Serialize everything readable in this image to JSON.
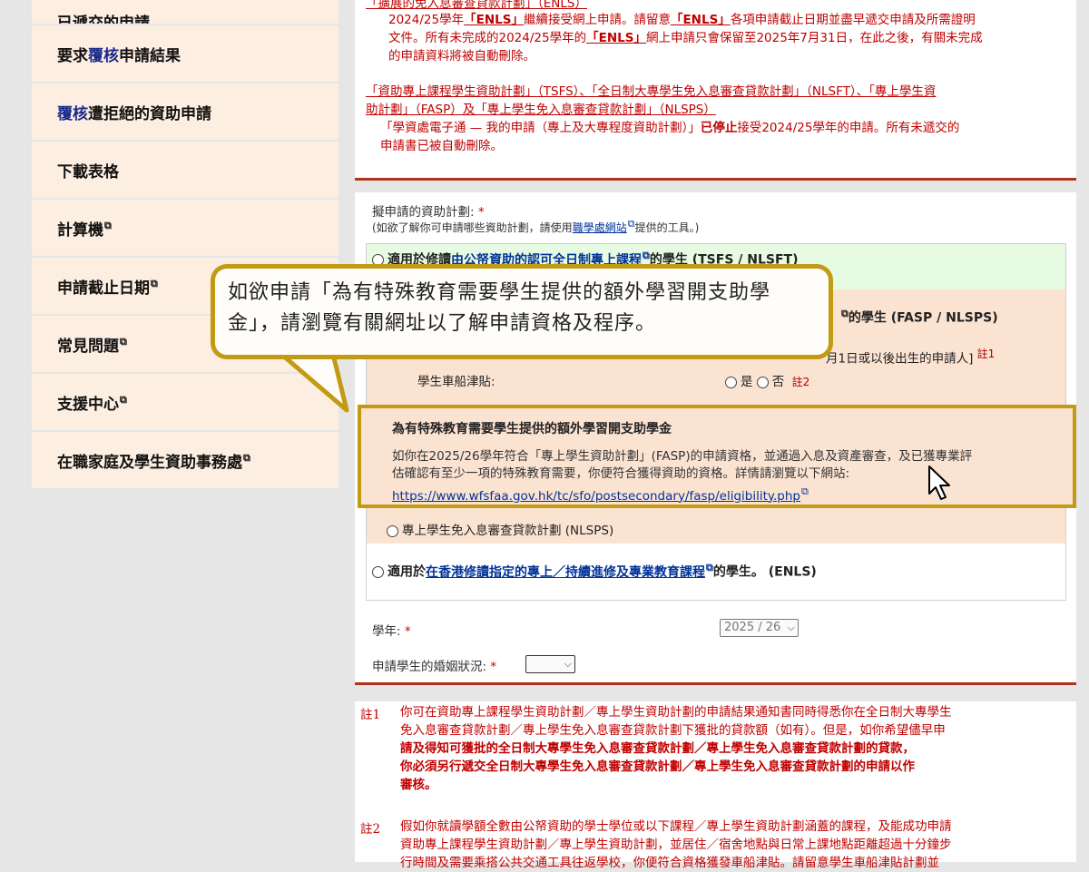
{
  "sidebar": {
    "items": [
      {
        "pre": "",
        "blue": "",
        "label": "已遞交的申請"
      },
      {
        "pre": "要求",
        "blue": "覆核",
        "label": "申請結果"
      },
      {
        "pre": "",
        "blue": "覆核",
        "label": "遭拒絕的資助申請"
      },
      {
        "pre": "",
        "blue": "",
        "label": "下載表格"
      },
      {
        "pre": "",
        "blue": "",
        "label": "計算機"
      },
      {
        "pre": "",
        "blue": "",
        "label": "申請截止日期"
      },
      {
        "pre": "",
        "blue": "",
        "label": "常見問題"
      },
      {
        "pre": "",
        "blue": "",
        "label": "支援中心"
      },
      {
        "pre": "",
        "blue": "",
        "label": "在職家庭及學生資助事務處"
      }
    ]
  },
  "notice": {
    "line0": "「擴展的免入息審查貸款計劃」（ENLS）",
    "p1_a": "2024/25學年",
    "p1_enls": "「ENLS」",
    "p1_b": "繼續接受網上申請。請留意",
    "p1_enls2": "「ENLS」",
    "p1_c": "各項申請截止日期並盡早遞交申請及所需證明",
    "p1_d": "文件。所有未完成的2024/25學年的",
    "p1_enls3": "「ENLS」",
    "p1_e": "網上申請只會保留至2025年7月31日，在此之後，有關未完成",
    "p1_f": "的申請資料將被自動刪除。",
    "p2_line1": "「資助專上課程學生資助計劃」（TSFS）、「全日制大專學生免入息審查貸款計劃」（NLSFT）、「專上學生資",
    "p2_line2": "助計劃」（FASP）及「專上學生免入息審查貸款計劃」（NLSPS）",
    "p2_a": "「學資處電子通 — 我的申請（專上及大專程度資助計劃）」",
    "p2_stop": "已停止",
    "p2_b": "接受2024/25學年的申請。所有未遞交的",
    "p2_c": "申請書已被自動刪除。"
  },
  "form": {
    "scheme_label": "擬申請的資助計劃:",
    "required_mark": "*",
    "scheme_hint_a": "(如欲了解你可申請哪些資助計劃，請使用",
    "scheme_hint_link": "職學處網站",
    "scheme_hint_b": "提供的工具。)",
    "option1_pre": "適用於修讀",
    "option1_link": "由公帑資助的認可全日制專上課程",
    "option1_post": "的學生 (TSFS / NLSFT)",
    "option2_post": "的學生 (FASP / NLSPS)",
    "option2_partial": "月1日或以後出生的申請人]",
    "note1_mark": "註1",
    "travel_label": "學生車船津貼:",
    "yes": "是",
    "no": "否",
    "note2_mark": "註2",
    "nlsps": "專上學生免入息審查貸款計劃 (NLSPS)",
    "option3_pre": "適用於",
    "option3_link": "在香港修讀指定的專上／持續進修及專業教育課程",
    "option3_post": "的學生。 (ENLS)",
    "year_label": "學年:",
    "year_value": "2025 / 26",
    "marital_label": "申請學生的婚姻狀況:",
    "marital_value": ""
  },
  "highlight": {
    "title": "為有特殊教育需要學生提供的額外學習開支助學金",
    "body_1": "如你在2025/26學年符合「專上學生資助計劃」(FASP)的申請資格，並通過入息及資產審查，及已獲專業評",
    "body_2": "估確認有至少一項的特殊教育需要，你便符合獲得資助的資格。詳情請瀏覽以下網站:",
    "url": "https://www.wfsfaa.gov.hk/tc/sfo/postsecondary/fasp/eligibility.php"
  },
  "notes": {
    "n1_label": "註1",
    "n1_1": "你可在資助專上課程學生資助計劃／專上學生資助計劃的申請結果通知書同時得悉你在全日制大專學生",
    "n1_2": "免入息審查貸款計劃／專上學生免入息審查貸款計劃下獲批的貸款額（如有）。但是，如你希望儘早申",
    "n1_3": "請及得知可獲批的全日制大專學生免入息審查貸款計劃／專上學生免入息審查貸款計劃的貸款，",
    "n1_4": "你必須另行遞交全日制大專學生免入息審查貸款計劃／專上學生免入息審查貸款計劃的申請以作",
    "n1_5": "審核。",
    "n2_label": "註2",
    "n2_1": "假如你就讀學額全數由公帑資助的學士學位或以下課程／專上學生資助計劃涵蓋的課程，及能成功申請",
    "n2_2": "資助專上課程學生資助計劃／專上學生資助計劃，並居住／宿舍地點與日常上課地點距離超過十分鐘步",
    "n2_3": "行時間及需要乘搭公共交通工具往返學校，你便符合資格獲發車船津貼。請留意學生車船津貼計劃並"
  },
  "callout": {
    "text": "如欲申請「為有特殊教育需要學生提供的額外學習開支助學金」，請瀏覽有關網址以了解申請資格及程序。"
  },
  "colors": {
    "accent_gold": "#c39a14",
    "notice_red": "#c00000",
    "peach": "#fbe3d2",
    "green": "#e6fbe2"
  }
}
